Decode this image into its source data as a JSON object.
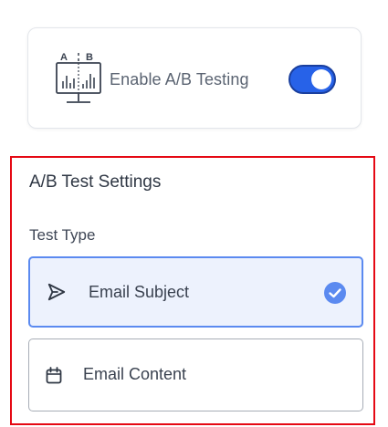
{
  "ab_toggle": {
    "label": "Enable A/B Testing",
    "icon": "ab-testing-chart-icon",
    "icon_letters": [
      "A",
      "B"
    ],
    "enabled": true
  },
  "settings": {
    "title": "A/B Test Settings",
    "test_type_label": "Test Type",
    "options": [
      {
        "label": "Email Subject",
        "icon": "send-icon",
        "selected": true
      },
      {
        "label": "Email Content",
        "icon": "calendar-icon",
        "selected": false
      }
    ]
  },
  "colors": {
    "toggle_on": "#2762e8",
    "selected_border": "#5b8af0",
    "selected_bg": "#edf2fd",
    "check": "#5b8af0",
    "highlight_frame": "#e50914"
  }
}
